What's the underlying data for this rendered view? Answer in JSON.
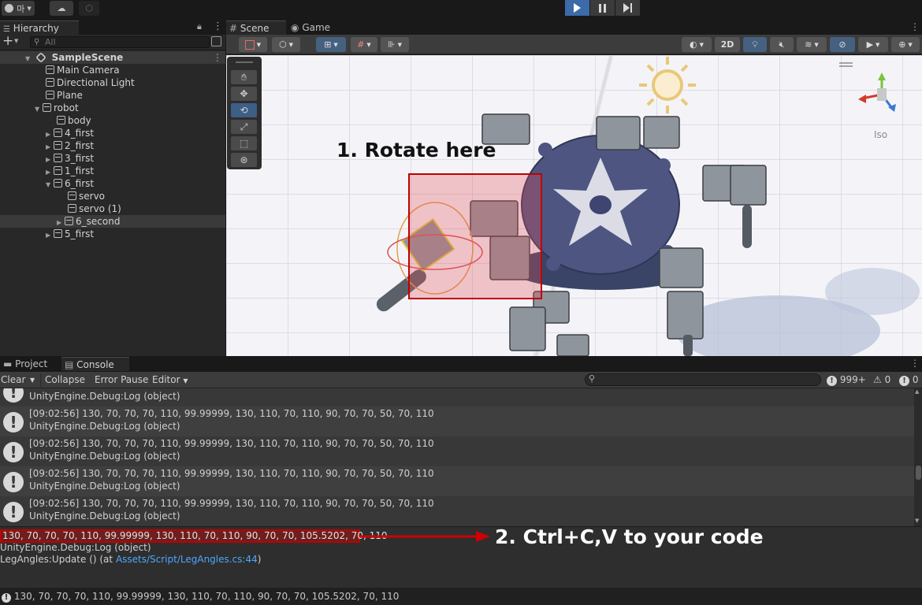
{
  "topbar": {
    "account_label": "마",
    "play_state": "stopped"
  },
  "hierarchy": {
    "tab_label": "Hierarchy",
    "search_placeholder": "All",
    "scene_name": "SampleScene",
    "items": [
      {
        "label": "Main Camera"
      },
      {
        "label": "Directional Light"
      },
      {
        "label": "Plane"
      },
      {
        "label": "robot"
      },
      {
        "label": "body"
      },
      {
        "label": "4_first"
      },
      {
        "label": "2_first"
      },
      {
        "label": "3_first"
      },
      {
        "label": "1_first"
      },
      {
        "label": "6_first"
      },
      {
        "label": "servo"
      },
      {
        "label": "servo (1)"
      },
      {
        "label": "6_second"
      },
      {
        "label": "5_first"
      }
    ]
  },
  "scene": {
    "tab_scene": "Scene",
    "tab_game": "Game",
    "mode_2d": "2D",
    "projection_label": "Iso",
    "annotation_rotate": "1. Rotate here",
    "selection_color": "#c00000"
  },
  "console": {
    "tab_project": "Project",
    "tab_console": "Console",
    "btn_clear": "Clear",
    "btn_collapse": "Collapse",
    "btn_error_pause": "Error Pause",
    "btn_editor": "Editor",
    "count_logs": "999+",
    "count_warnings": "0",
    "count_errors": "0",
    "rows": [
      {
        "time": "",
        "message": "",
        "source": "UnityEngine.Debug:Log (object)"
      },
      {
        "time": "[09:02:56]",
        "message": "130, 70, 70, 70, 110, 99.99999, 130, 110, 70, 110, 90, 70, 70, 50, 70, 110",
        "source": "UnityEngine.Debug:Log (object)"
      },
      {
        "time": "[09:02:56]",
        "message": "130, 70, 70, 70, 110, 99.99999, 130, 110, 70, 110, 90, 70, 70, 50, 70, 110",
        "source": "UnityEngine.Debug:Log (object)"
      },
      {
        "time": "[09:02:56]",
        "message": "130, 70, 70, 70, 110, 99.99999, 130, 110, 70, 110, 90, 70, 70, 50, 70, 110",
        "source": "UnityEngine.Debug:Log (object)"
      },
      {
        "time": "[09:02:56]",
        "message": "130, 70, 70, 70, 110, 99.99999, 130, 110, 70, 110, 90, 70, 70, 50, 70, 110",
        "source": "UnityEngine.Debug:Log (object)"
      }
    ],
    "detail": {
      "line1": "130, 70, 70, 70, 110, 99.99999, 130, 110, 70, 110, 90, 70, 70, 105.5202, 70, 110",
      "line2": "UnityEngine.Debug:Log (object)",
      "line3_prefix": "LegAngles:Update () (at ",
      "line3_link": "Assets/Script/LegAngles.cs:44",
      "line3_suffix": ")"
    },
    "annotation_copy": "2. Ctrl+C,V to your code",
    "link_color": "#4ea6ff"
  },
  "statusbar": {
    "message": "130, 70, 70, 70, 110, 99.99999, 130, 110, 70, 110, 90, 70, 70, 105.5202, 70, 110"
  }
}
